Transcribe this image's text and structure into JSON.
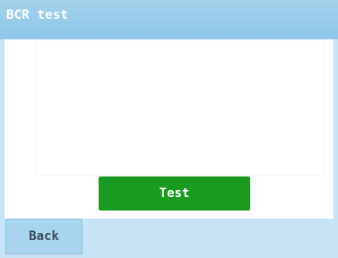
{
  "window": {
    "title": "BCR test"
  },
  "main": {
    "test_button_label": "Test"
  },
  "footer": {
    "back_label": "Back"
  },
  "colors": {
    "title_bar": "#a3d3ee",
    "frame": "#c8e4f4",
    "primary_button": "#1a9a1f",
    "primary_text": "#ffffff",
    "secondary_button": "#a9d5ee",
    "secondary_text": "#3a4b58"
  }
}
